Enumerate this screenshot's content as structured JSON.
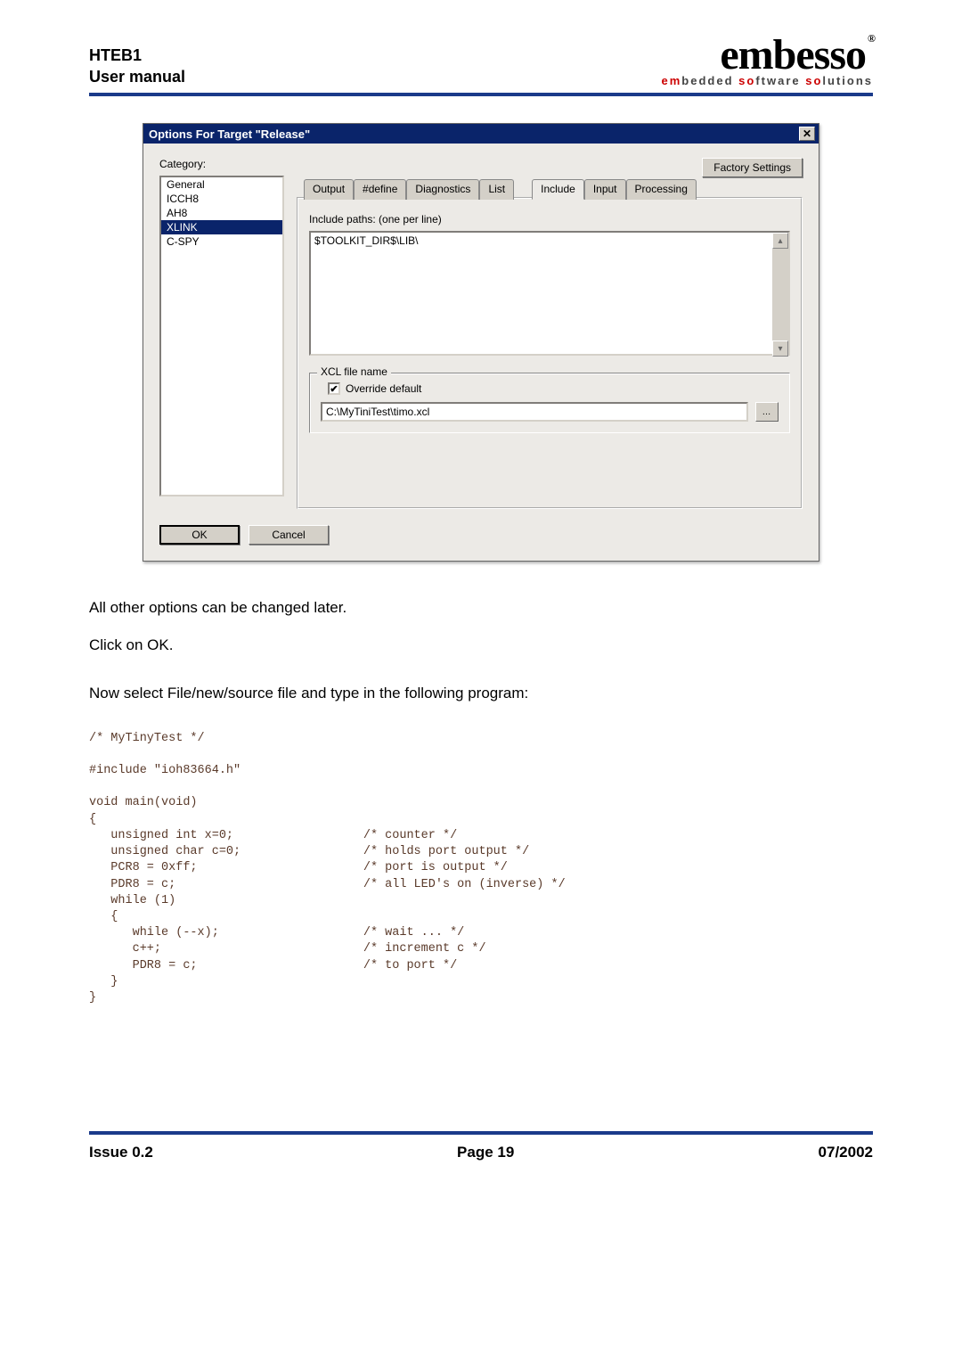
{
  "header": {
    "product": "HTEB1",
    "subtitle": "User manual",
    "logo_main": "embesso",
    "logo_sub_red1": "em",
    "logo_sub_1": "bedded ",
    "logo_sub_red2": "so",
    "logo_sub_2": "ftware ",
    "logo_sub_red3": "so",
    "logo_sub_3": "lutions"
  },
  "dialog": {
    "title": "Options For Target \"Release\"",
    "close": "✕",
    "category_label": "Category:",
    "categories": [
      "General",
      "ICCH8",
      "AH8",
      "XLINK",
      "C-SPY"
    ],
    "selected_category_index": 3,
    "factory_btn": "Factory Settings",
    "tabs": [
      "Output",
      "#define",
      "Diagnostics",
      "List",
      "Include",
      "Input",
      "Processing"
    ],
    "active_tab_index": 4,
    "include_label": "Include paths: (one per line)",
    "include_value": "$TOOLKIT_DIR$\\LIB\\",
    "xcl_group": "XCL file name",
    "override_label": "Override default",
    "override_checked": true,
    "xcl_value": "C:\\MyTiniTest\\timo.xcl",
    "browse_icon": "…",
    "ok": "OK",
    "cancel": "Cancel"
  },
  "body": {
    "p1": "All other options can be changed later.",
    "p2": "Click on OK.",
    "p3": "Now select File/new/source file and type in the following program:"
  },
  "code": "/* MyTinyTest */\n\n#include \"ioh83664.h\"\n\nvoid main(void)\n{\n   unsigned int x=0;                  /* counter */\n   unsigned char c=0;                 /* holds port output */\n   PCR8 = 0xff;                       /* port is output */\n   PDR8 = c;                          /* all LED's on (inverse) */\n   while (1)\n   {\n      while (--x);                    /* wait ... */\n      c++;                            /* increment c */\n      PDR8 = c;                       /* to port */\n   }\n}",
  "footer": {
    "issue": "Issue 0.2",
    "page": "Page 19",
    "date": "07/2002"
  }
}
